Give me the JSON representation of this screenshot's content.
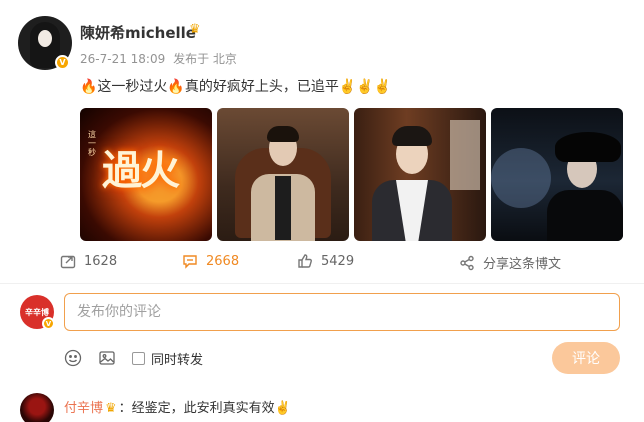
{
  "post": {
    "author": "陳妍希michelle",
    "crown_icon": "crown-icon",
    "date": "26-7-21 18:09",
    "source": "发布于 北京",
    "content": "🔥这一秒过火🔥真的好疯好上头，已追平✌️✌️✌️",
    "thumbnails": [
      {
        "name": "poster-guohuo",
        "fire_title": "過火",
        "side_text": "這一秒"
      },
      {
        "name": "still-man-in-chair"
      },
      {
        "name": "still-young-man-vest"
      },
      {
        "name": "still-woman-in-hat"
      }
    ]
  },
  "actions": {
    "repost_count": "1628",
    "comment_count": "2668",
    "like_count": "5429",
    "share_label": "分享这条博文"
  },
  "composer": {
    "avatar_text": "辛辛博",
    "placeholder": "发布你的评论",
    "repost_label": "同时转发",
    "submit_label": "评论"
  },
  "comment": {
    "user": "付辛博",
    "text": "：经鉴定，此安利真实有效✌️"
  },
  "colors": {
    "accent": "#f08a24",
    "username": "#eb7350",
    "submit_bg": "#fbc89b"
  }
}
